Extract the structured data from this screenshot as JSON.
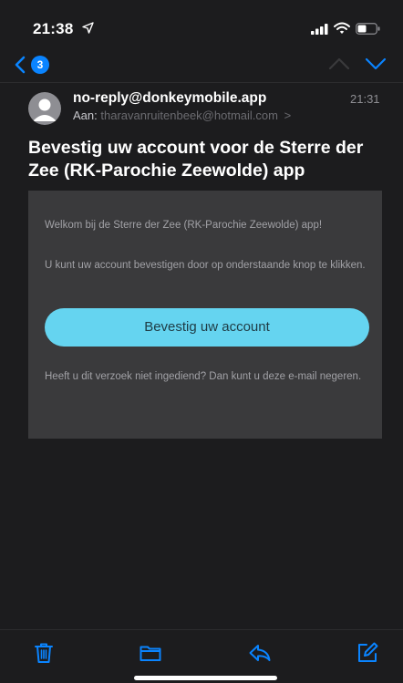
{
  "status_bar": {
    "time": "21:38"
  },
  "nav": {
    "unread_count": "3"
  },
  "message": {
    "sender": "no-reply@donkeymobile.app",
    "received_time": "21:31",
    "recipient_label": "Aan:",
    "recipient_address": "tharavanruitenbeek@hotmail.com",
    "recipient_chevron": ">",
    "subject": "Bevestig uw account voor de Sterre der Zee (RK-Parochie Zeewolde) app"
  },
  "email_body": {
    "welcome": "Welkom bij de Sterre der Zee (RK-Parochie Zeewolde) app!",
    "instruction": "U kunt uw account bevestigen door op onderstaande knop te klikken.",
    "confirm_button": "Bevestig uw account",
    "ignore_notice": "Heeft u dit verzoek niet ingediend? Dan kunt u deze e-mail negeren."
  },
  "toolbar": {
    "icons": [
      "trash-icon",
      "folder-icon",
      "reply-icon",
      "compose-icon"
    ]
  },
  "colors": {
    "background": "#1c1c1e",
    "card": "#3a3a3c",
    "accent": "#0a84ff",
    "button": "#65d4f0",
    "muted_text": "#8e8e93"
  }
}
